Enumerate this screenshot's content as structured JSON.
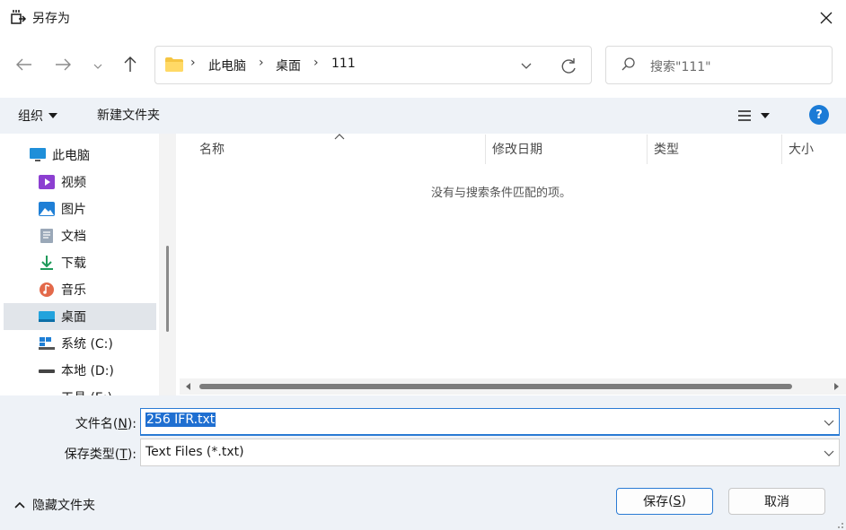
{
  "window": {
    "title": "另存为"
  },
  "address": {
    "crumbs": [
      "此电脑",
      "桌面",
      "111"
    ]
  },
  "search": {
    "placeholder": "搜索\"111\""
  },
  "toolbar": {
    "organize_label": "组织",
    "new_folder_label": "新建文件夹"
  },
  "nav": {
    "items": [
      {
        "label": "此电脑",
        "icon": "computer-icon"
      },
      {
        "label": "视频",
        "icon": "video-icon"
      },
      {
        "label": "图片",
        "icon": "pictures-icon"
      },
      {
        "label": "文档",
        "icon": "documents-icon"
      },
      {
        "label": "下载",
        "icon": "download-icon"
      },
      {
        "label": "音乐",
        "icon": "music-icon"
      },
      {
        "label": "桌面",
        "icon": "desktop-icon",
        "selected": true
      },
      {
        "label": "系统 (C:)",
        "icon": "drive-icon"
      },
      {
        "label": "本地 (D:)",
        "icon": "drive-icon"
      },
      {
        "label": "工具 (E:)",
        "icon": "drive-icon"
      }
    ]
  },
  "columns": {
    "name": "名称",
    "modified": "修改日期",
    "type": "类型",
    "size": "大小"
  },
  "empty_message": "没有与搜索条件匹配的项。",
  "form": {
    "filename_label": "文件名",
    "filename_hotkey": "N",
    "filename_value": "256 IFR.txt",
    "filetype_label": "保存类型",
    "filetype_hotkey": "T",
    "filetype_value": "Text Files (*.txt)"
  },
  "footer": {
    "hide_folders_label": "隐藏文件夹",
    "save_label": "保存",
    "save_hotkey": "S",
    "cancel_label": "取消"
  },
  "colors": {
    "accent": "#1b7bd6",
    "toolbar_bg": "#eef2f7",
    "selected_bg": "#e1e5ea"
  }
}
